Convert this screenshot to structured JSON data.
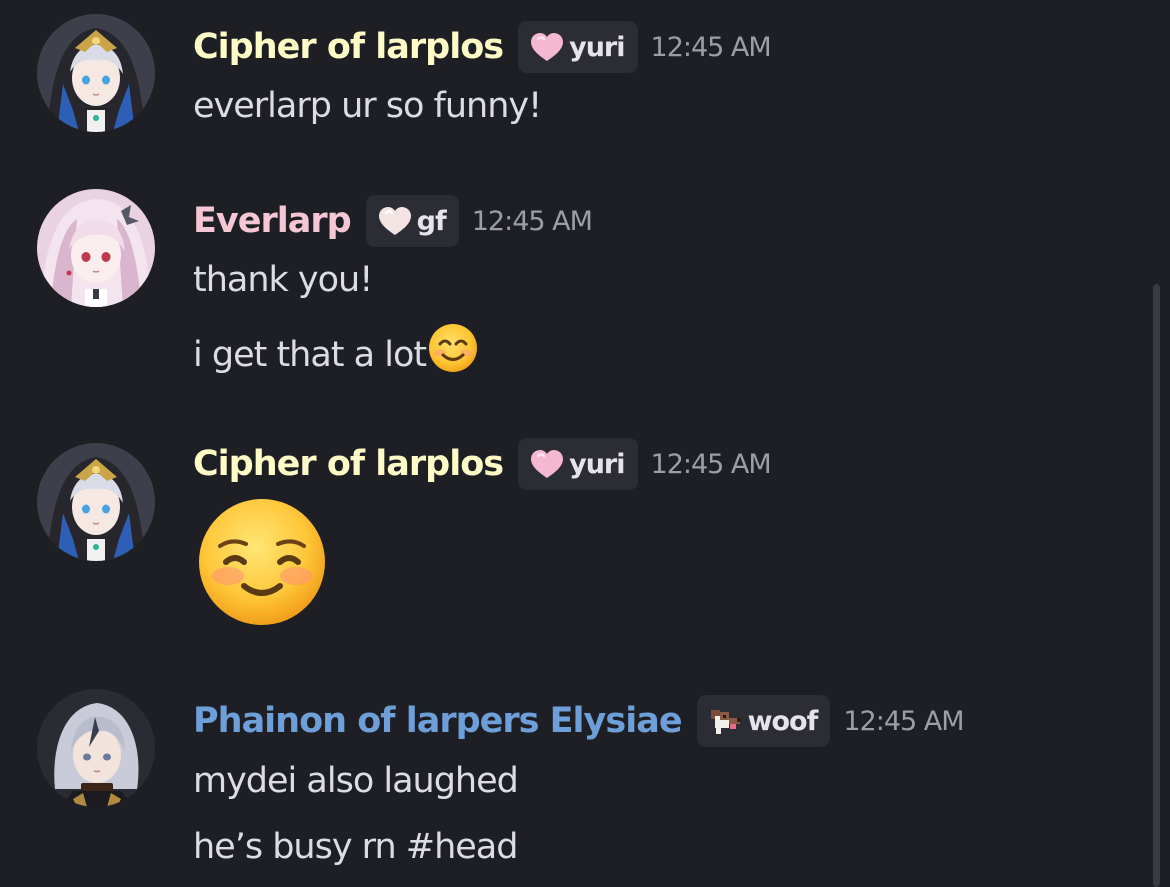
{
  "colors": {
    "background": "#1e1f24",
    "tag_background": "#2c2d34",
    "timestamp": "#9c9da6",
    "message_text": "#dcdde2",
    "name_yellow": "#fffbc7",
    "name_pink": "#f5c7d4",
    "name_blue": "#6e9fd8"
  },
  "messages": [
    {
      "author": "Cipher of larplos",
      "tag_icon": "pink-heart-icon",
      "tag": "yuri",
      "time": "12:45 AM",
      "lines": [
        "everlarp ur so funny!"
      ]
    },
    {
      "author": "Everlarp",
      "tag_icon": "white-heart-icon",
      "tag": "gf",
      "time": "12:45 AM",
      "lines": [
        "thank you!",
        "i get that a lot"
      ],
      "inline_emoji": "smiling-face-emoji"
    },
    {
      "author": "Cipher of larplos",
      "tag_icon": "pink-heart-icon",
      "tag": "yuri",
      "time": "12:45 AM",
      "big_emoji": "blushing-smile-emoji"
    },
    {
      "author": "Phainon of larpers Elysiae",
      "tag_icon": "dog-icon",
      "tag": "woof",
      "time": "12:45 AM",
      "lines": [
        "mydei also laughed",
        "he’s busy rn #head"
      ]
    }
  ]
}
